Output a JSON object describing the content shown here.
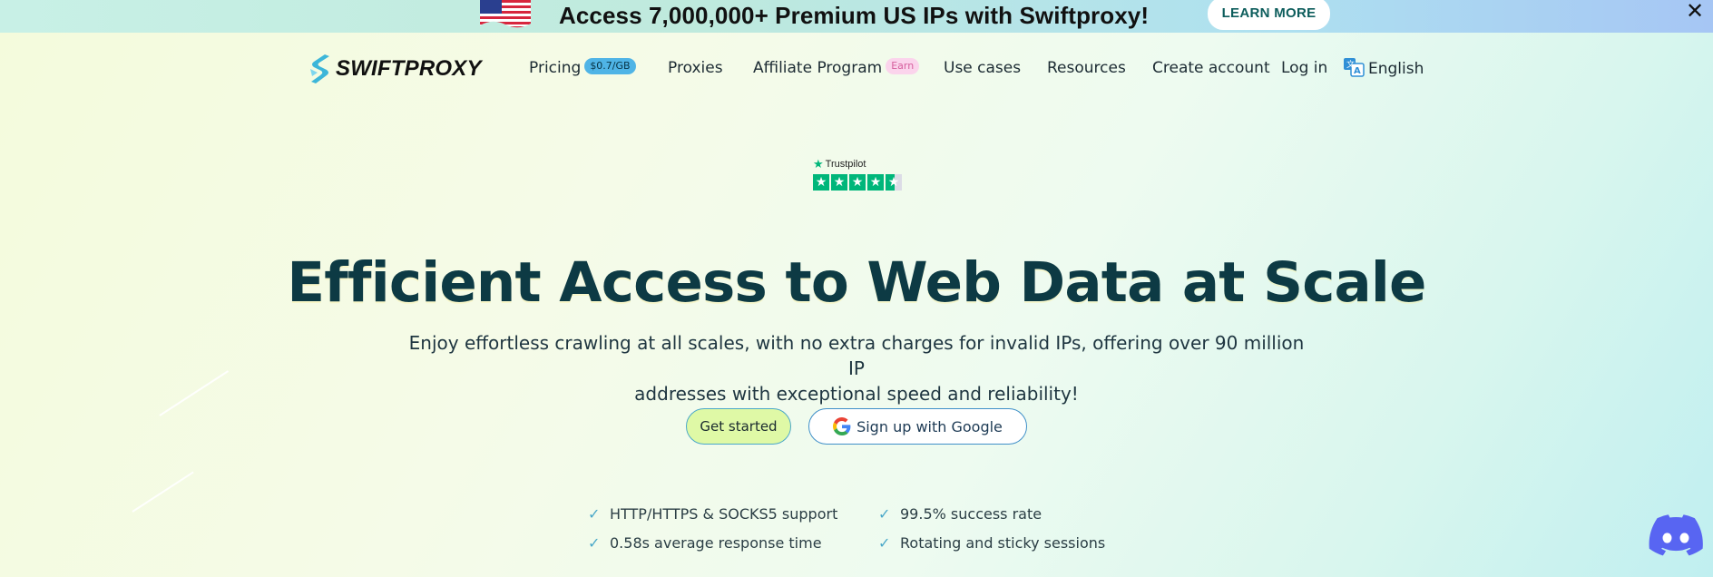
{
  "banner": {
    "headline": "Access 7,000,000+ Premium US IPs with Swiftproxy!",
    "cta_label": "LEARN MORE",
    "close_symbol": "✕"
  },
  "nav": {
    "logo_text": "SWIFTPROXY",
    "items": {
      "pricing": "Pricing",
      "pricing_badge": "$0.7/GB",
      "proxies": "Proxies",
      "affiliate": "Affiliate Program",
      "affiliate_badge": "Earn",
      "use_cases": "Use cases",
      "resources": "Resources",
      "create_account": "Create account",
      "login": "Log in",
      "language": "English"
    }
  },
  "trustpilot": {
    "label": "Trustpilot",
    "rating_stars": 4.5
  },
  "hero": {
    "title": "Efficient Access to Web Data at Scale",
    "subtitle_line1": "Enjoy effortless crawling at all scales, with no extra charges for invalid IPs, offering over 90 million IP",
    "subtitle_line2": "addresses with exceptional speed and reliability!",
    "primary_cta": "Get started",
    "google_cta": "Sign up with Google"
  },
  "features": [
    "HTTP/HTTPS & SOCKS5 support",
    "99.5% success rate",
    "0.58s average response time",
    "Rotating and sticky sessions"
  ],
  "colors": {
    "accent_teal": "#4aa8c9",
    "primary_button": "#dff9a6",
    "trustpilot_green": "#00b67a",
    "title_color": "#0d3a44",
    "discord": "#5865f2"
  },
  "icons": {
    "flag": "us-flag-icon",
    "close": "close-icon",
    "language": "translate-icon",
    "google": "google-icon",
    "check": "check-icon",
    "discord": "discord-icon"
  }
}
